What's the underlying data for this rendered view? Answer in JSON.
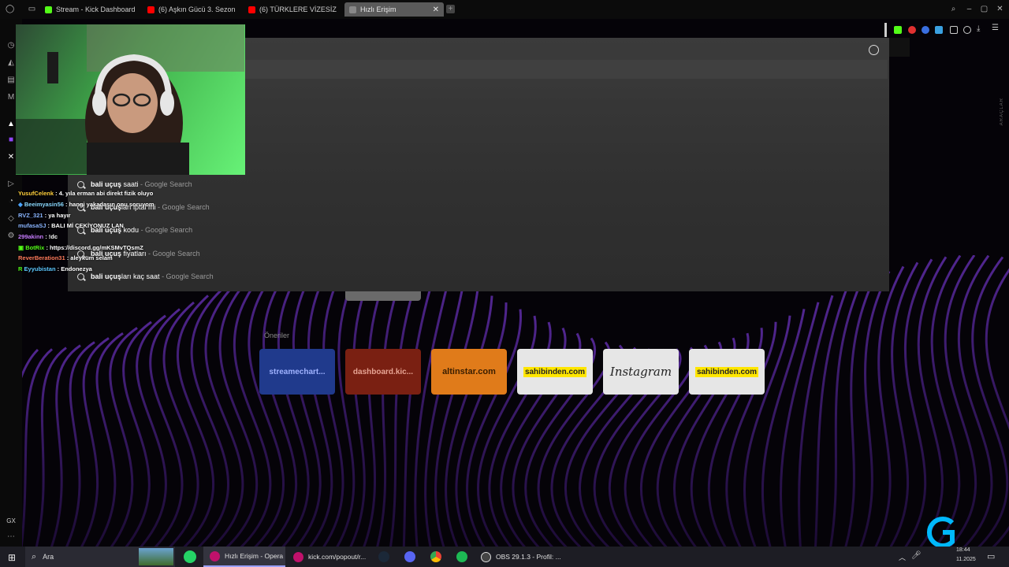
{
  "tabs": [
    {
      "label": "Stream - Kick Dashboard",
      "icon": "kick-icon",
      "color": "#53fc18"
    },
    {
      "label": "(6) Aşkın Gücü 3. Sezon :",
      "icon": "youtube-icon",
      "color": "#ff0000"
    },
    {
      "label": "(6) TÜRKLERE VİZESİZ Ol",
      "icon": "youtube-icon",
      "color": "#ff0000"
    },
    {
      "label": "Hızlı Erişim",
      "icon": "speed-dial-icon",
      "active": true
    }
  ],
  "sidebar": {
    "bottom_label": "GX",
    "icons": [
      "history-icon",
      "bag-icon",
      "notes-icon",
      "m-icon",
      "kick-icon",
      "twitch-icon",
      "x-icon",
      "play-icon",
      "clock-icon",
      "cube-icon",
      "settings-icon"
    ]
  },
  "address_bar": {
    "value": ""
  },
  "right_panel_label": "ARAÇLAR",
  "suggestions": [
    {
      "bold": "bali uçuş",
      "rest": " saati",
      "source": "- Google Search"
    },
    {
      "bold": "bali uçuş",
      "rest": "ları iptal mi",
      "source": "- Google Search"
    },
    {
      "bold": "bali uçuş",
      "rest": " kodu",
      "source": "- Google Search"
    },
    {
      "bold": "bali uçuş",
      "rest": " fiyatları",
      "source": "- Google Search"
    },
    {
      "bold": "bali uçuş",
      "rest": "ları kaç saat",
      "source": "- Google Search"
    }
  ],
  "speed_dial": {
    "section_label": "Öneriler",
    "items": [
      {
        "label": "streamechart...",
        "bg": "#203a8c",
        "fg": "#9fb2ff"
      },
      {
        "label": "dashboard.kic...",
        "bg": "#7a2012",
        "fg": "#e7a493"
      },
      {
        "label": "altinstar.com",
        "bg": "#e07b1a",
        "fg": "#3a1e00"
      },
      {
        "label": "sahibinden.com",
        "bg": "#e6e6e6",
        "fg": "#222"
      },
      {
        "label": "Instagram",
        "bg": "#e6e6e6",
        "fg": "#222"
      },
      {
        "label": "sahibinden.com",
        "bg": "#e6e6e6",
        "fg": "#222"
      }
    ]
  },
  "chat": [
    {
      "user": "YusufCelenk",
      "color": "#ffcf3c",
      "text": ": 4. yıla erman abi direkt fizik oluyo"
    },
    {
      "user": "Beeimyasin56",
      "color": "#8ad8ff",
      "text": ": hangi yakadasın onu soruyom"
    },
    {
      "user": "RVZ_321",
      "color": "#8ab4ff",
      "text": ": ya hayır"
    },
    {
      "user": "mufasaSJ",
      "color": "#8ab4ff",
      "text": ": BALI Mİ ÇEKİYONUZ LAN"
    },
    {
      "user": "299akinn",
      "color": "#c87dff",
      "text": ": !dc"
    },
    {
      "user": "BotRix",
      "color": "#53fc18",
      "text": ": https://discord.gg/mKSMvTQsmZ"
    },
    {
      "user": "ReverBeration31",
      "color": "#ff7b5c",
      "text": ": aleyküm selam"
    },
    {
      "user": "Eyyubistan",
      "color": "#5cc8ff",
      "text": ": Endonezya"
    }
  ],
  "taskbar": {
    "search_placeholder": "Ara",
    "items": [
      {
        "label": "Hızlı Erişim - Opera",
        "color": "#c0116b"
      },
      {
        "label": "kick.com/popout/r...",
        "color": "#c0116b"
      },
      {
        "label": "OBS 29.1.3 - Profil: ...",
        "color": "#444"
      }
    ],
    "time": "18:44",
    "date": "11.2025",
    "watermark": "logitech"
  }
}
